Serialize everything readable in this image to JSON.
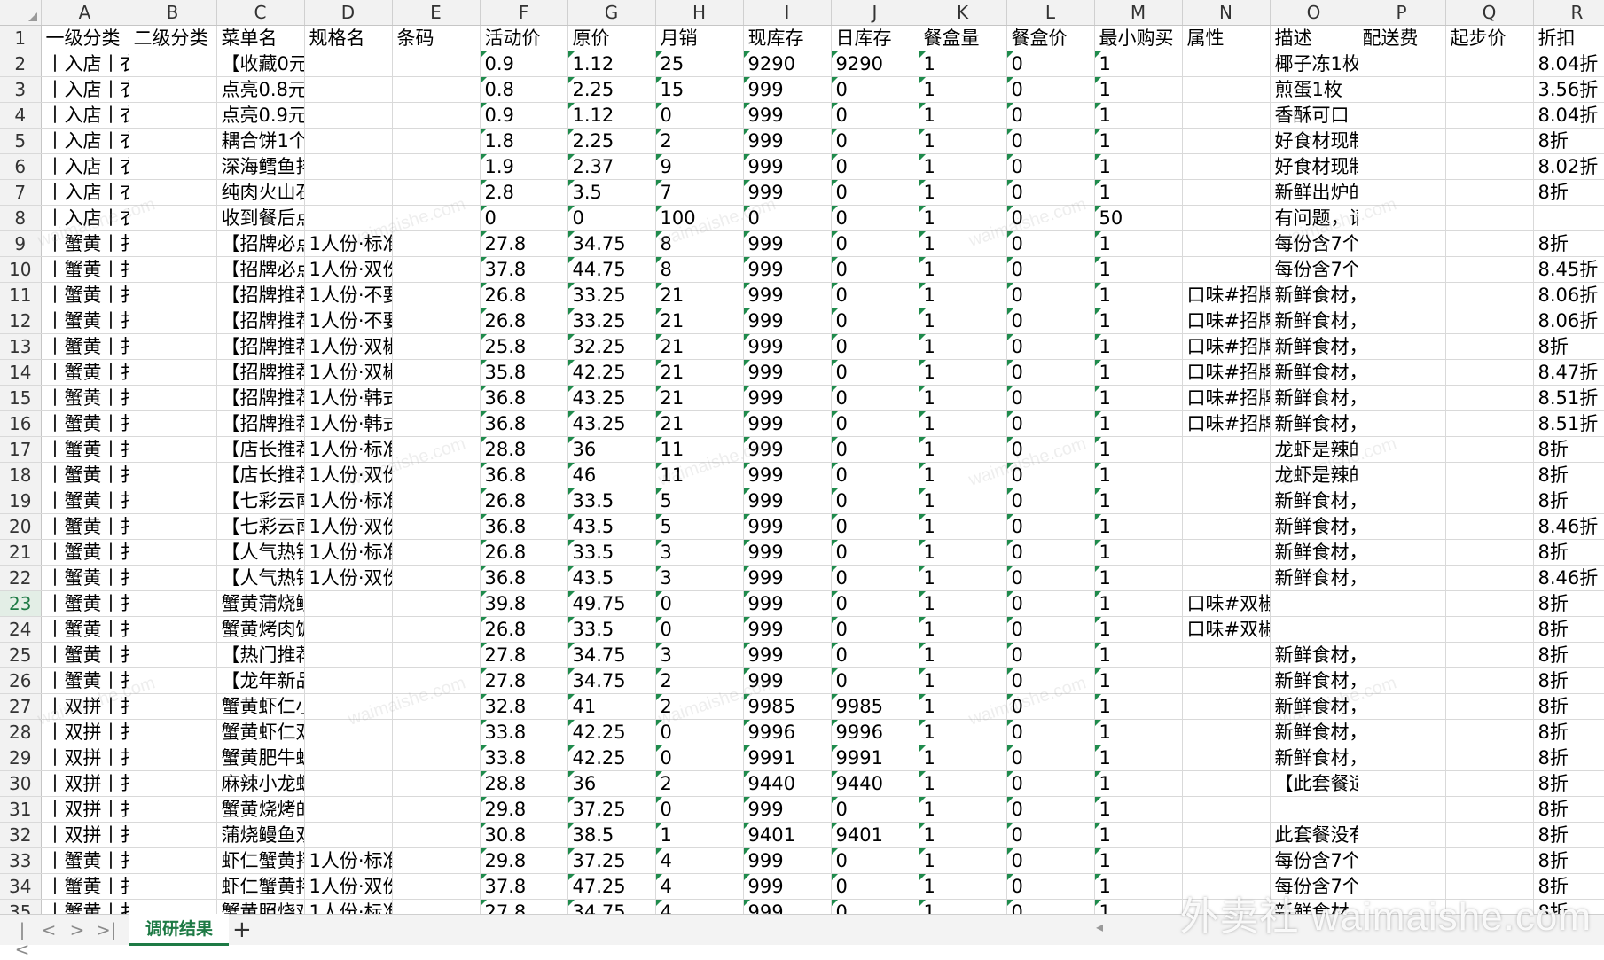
{
  "columns": [
    "A",
    "B",
    "C",
    "D",
    "E",
    "F",
    "G",
    "H",
    "I",
    "J",
    "K",
    "L",
    "M",
    "N",
    "O",
    "P",
    "Q",
    "R"
  ],
  "headers": [
    "一级分类",
    "二级分类",
    "菜单名",
    "规格名",
    "条码",
    "活动价",
    "原价",
    "月销",
    "现库存",
    "日库存",
    "餐盒量",
    "餐盒价",
    "最小购买",
    "属性",
    "描述",
    "配送费",
    "起步价",
    "折扣"
  ],
  "rows": [
    [
      "丨入店丨衣",
      "",
      "【收藏0元",
      "",
      "",
      "0.9",
      "1.12",
      "25",
      "9290",
      "9290",
      "1",
      "0",
      "1",
      "",
      "椰子冻1枚",
      "",
      "",
      "8.04折"
    ],
    [
      "丨入店丨衣",
      "",
      "点亮0.8元",
      "",
      "",
      "0.8",
      "2.25",
      "15",
      "999",
      "0",
      "1",
      "0",
      "1",
      "",
      "煎蛋1枚",
      "",
      "",
      "3.56折"
    ],
    [
      "丨入店丨衣",
      "",
      "点亮0.9元",
      "",
      "",
      "0.9",
      "1.12",
      "0",
      "999",
      "0",
      "1",
      "0",
      "1",
      "",
      "香酥可口",
      "",
      "",
      "8.04折"
    ],
    [
      "丨入店丨衣",
      "",
      "耦合饼1个",
      "",
      "",
      "1.8",
      "2.25",
      "2",
      "999",
      "0",
      "1",
      "0",
      "1",
      "",
      "好食材现制",
      "",
      "",
      "8折"
    ],
    [
      "丨入店丨衣",
      "",
      "深海鳕鱼排",
      "",
      "",
      "1.9",
      "2.37",
      "9",
      "999",
      "0",
      "1",
      "0",
      "1",
      "",
      "好食材现制",
      "",
      "",
      "8.02折"
    ],
    [
      "丨入店丨衣",
      "",
      "纯肉火山石",
      "",
      "",
      "2.8",
      "3.5",
      "7",
      "999",
      "0",
      "1",
      "0",
      "1",
      "",
      "新鲜出炉的",
      "",
      "",
      "8折"
    ],
    [
      "丨入店丨衣",
      "",
      "收到餐后点",
      "",
      "",
      "0",
      "0",
      "100",
      "0",
      "0",
      "1",
      "0",
      "50",
      "",
      "有问题，请",
      "",
      "",
      ""
    ],
    [
      "丨蟹黄丨扌",
      "",
      "【招牌必点",
      "1人份·标准",
      "",
      "27.8",
      "34.75",
      "8",
      "999",
      "0",
      "1",
      "0",
      "1",
      "",
      "每份含7个",
      "",
      "",
      "8折"
    ],
    [
      "丨蟹黄丨扌",
      "",
      "【招牌必点",
      "1人份·双份",
      "",
      "37.8",
      "44.75",
      "8",
      "999",
      "0",
      "1",
      "0",
      "1",
      "",
      "每份含7个",
      "",
      "",
      "8.45折"
    ],
    [
      "丨蟹黄丨扌",
      "",
      "【招牌推荐",
      "1人份·不要",
      "",
      "26.8",
      "33.25",
      "21",
      "999",
      "0",
      "1",
      "0",
      "1",
      "口味#招牌",
      "新鲜食材，",
      "",
      "",
      "8.06折"
    ],
    [
      "丨蟹黄丨扌",
      "",
      "【招牌推荐",
      "1人份·不要",
      "",
      "26.8",
      "33.25",
      "21",
      "999",
      "0",
      "1",
      "0",
      "1",
      "口味#招牌",
      "新鲜食材，",
      "",
      "",
      "8.06折"
    ],
    [
      "丨蟹黄丨扌",
      "",
      "【招牌推荐",
      "1人份·双椒",
      "",
      "25.8",
      "32.25",
      "21",
      "999",
      "0",
      "1",
      "0",
      "1",
      "口味#招牌",
      "新鲜食材，",
      "",
      "",
      "8折"
    ],
    [
      "丨蟹黄丨扌",
      "",
      "【招牌推荐",
      "1人份·双椒",
      "",
      "35.8",
      "42.25",
      "21",
      "999",
      "0",
      "1",
      "0",
      "1",
      "口味#招牌",
      "新鲜食材，",
      "",
      "",
      "8.47折"
    ],
    [
      "丨蟹黄丨扌",
      "",
      "【招牌推荐",
      "1人份·韩式",
      "",
      "36.8",
      "43.25",
      "21",
      "999",
      "0",
      "1",
      "0",
      "1",
      "口味#招牌",
      "新鲜食材，",
      "",
      "",
      "8.51折"
    ],
    [
      "丨蟹黄丨扌",
      "",
      "【招牌推荐",
      "1人份·韩式",
      "",
      "36.8",
      "43.25",
      "21",
      "999",
      "0",
      "1",
      "0",
      "1",
      "口味#招牌",
      "新鲜食材，",
      "",
      "",
      "8.51折"
    ],
    [
      "丨蟹黄丨扌",
      "",
      "【店长推荐",
      "1人份·标准",
      "",
      "28.8",
      "36",
      "11",
      "999",
      "0",
      "1",
      "0",
      "1",
      "",
      "龙虾是辣的",
      "",
      "",
      "8折"
    ],
    [
      "丨蟹黄丨扌",
      "",
      "【店长推荐",
      "1人份·双份",
      "",
      "36.8",
      "46",
      "11",
      "999",
      "0",
      "1",
      "0",
      "1",
      "",
      "龙虾是辣的",
      "",
      "",
      "8折"
    ],
    [
      "丨蟹黄丨扌",
      "",
      "【七彩云南",
      "1人份·标准",
      "",
      "26.8",
      "33.5",
      "5",
      "999",
      "0",
      "1",
      "0",
      "1",
      "",
      "新鲜食材，",
      "",
      "",
      "8折"
    ],
    [
      "丨蟹黄丨扌",
      "",
      "【七彩云南",
      "1人份·双份",
      "",
      "36.8",
      "43.5",
      "5",
      "999",
      "0",
      "1",
      "0",
      "1",
      "",
      "新鲜食材，",
      "",
      "",
      "8.46折"
    ],
    [
      "丨蟹黄丨扌",
      "",
      "【人气热销",
      "1人份·标准",
      "",
      "26.8",
      "33.5",
      "3",
      "999",
      "0",
      "1",
      "0",
      "1",
      "",
      "新鲜食材，",
      "",
      "",
      "8折"
    ],
    [
      "丨蟹黄丨扌",
      "",
      "【人气热销",
      "1人份·双份",
      "",
      "36.8",
      "43.5",
      "3",
      "999",
      "0",
      "1",
      "0",
      "1",
      "",
      "新鲜食材，",
      "",
      "",
      "8.46折"
    ],
    [
      "丨蟹黄丨扌",
      "",
      "蟹黄蒲烧鳗",
      "",
      "",
      "39.8",
      "49.75",
      "0",
      "999",
      "0",
      "1",
      "0",
      "1",
      "口味#双椒",
      "",
      "",
      "",
      "8折"
    ],
    [
      "丨蟹黄丨扌",
      "",
      "蟹黄烤肉饭",
      "",
      "",
      "26.8",
      "33.5",
      "0",
      "999",
      "0",
      "1",
      "0",
      "1",
      "口味#双椒",
      "",
      "",
      "",
      "8折"
    ],
    [
      "丨蟹黄丨扌",
      "",
      "【热门推荐",
      "",
      "",
      "27.8",
      "34.75",
      "3",
      "999",
      "0",
      "1",
      "0",
      "1",
      "",
      "新鲜食材，",
      "",
      "",
      "8折"
    ],
    [
      "丨蟹黄丨扌",
      "",
      "【龙年新品",
      "",
      "",
      "27.8",
      "34.75",
      "2",
      "999",
      "0",
      "1",
      "0",
      "1",
      "",
      "新鲜食材，",
      "",
      "",
      "8折"
    ],
    [
      "丨双拼丨扌",
      "",
      "蟹黄虾仁小",
      "",
      "",
      "32.8",
      "41",
      "2",
      "9985",
      "9985",
      "1",
      "0",
      "1",
      "",
      "新鲜食材，",
      "",
      "",
      "8折"
    ],
    [
      "丨双拼丨扌",
      "",
      "蟹黄虾仁双",
      "",
      "",
      "33.8",
      "42.25",
      "0",
      "9996",
      "9996",
      "1",
      "0",
      "1",
      "",
      "新鲜食材，",
      "",
      "",
      "8折"
    ],
    [
      "丨双拼丨扌",
      "",
      "蟹黄肥牛蛙",
      "",
      "",
      "33.8",
      "42.25",
      "0",
      "9991",
      "9991",
      "1",
      "0",
      "1",
      "",
      "新鲜食材，",
      "",
      "",
      "8折"
    ],
    [
      "丨双拼丨扌",
      "",
      "麻辣小龙虾",
      "",
      "",
      "28.8",
      "36",
      "2",
      "9440",
      "9440",
      "1",
      "0",
      "1",
      "",
      "【此套餐适",
      "",
      "",
      "8折"
    ],
    [
      "丨双拼丨扌",
      "",
      "蟹黄烧烤的",
      "",
      "",
      "29.8",
      "37.25",
      "0",
      "999",
      "0",
      "1",
      "0",
      "1",
      "",
      "",
      "",
      "",
      "8折"
    ],
    [
      "丨双拼丨扌",
      "",
      "蒲烧鳗鱼双",
      "",
      "",
      "30.8",
      "38.5",
      "1",
      "9401",
      "9401",
      "1",
      "0",
      "1",
      "",
      "此套餐没有",
      "",
      "",
      "8折"
    ],
    [
      "丨蟹黄丨扌",
      "",
      "虾仁蟹黄拌",
      "1人份·标准",
      "",
      "29.8",
      "37.25",
      "4",
      "999",
      "0",
      "1",
      "0",
      "1",
      "",
      "每份含7个",
      "",
      "",
      "8折"
    ],
    [
      "丨蟹黄丨扌",
      "",
      "虾仁蟹黄拌",
      "1人份·双份",
      "",
      "37.8",
      "47.25",
      "4",
      "999",
      "0",
      "1",
      "0",
      "1",
      "",
      "每份含7个",
      "",
      "",
      "8折"
    ],
    [
      "丨蟹黄丨扌",
      "",
      "蟹黄照烧鸡",
      "1人份·标准",
      "",
      "27.8",
      "34.75",
      "4",
      "999",
      "0",
      "1",
      "0",
      "1",
      "",
      "新鲜食材，",
      "",
      "",
      "8折"
    ]
  ],
  "active_row": "23",
  "sheet_tab": "调研结果",
  "add_sheet_symbol": "+",
  "nav_symbols": [
    "|<",
    "<",
    ">",
    ">|"
  ],
  "watermark_text": "waimaishe.com",
  "brand_text": "外卖社 waimaishe.com",
  "colors": {
    "accent": "#1e7a45",
    "header_bg": "#f2f2f2",
    "gridline": "#d9d9d9"
  }
}
